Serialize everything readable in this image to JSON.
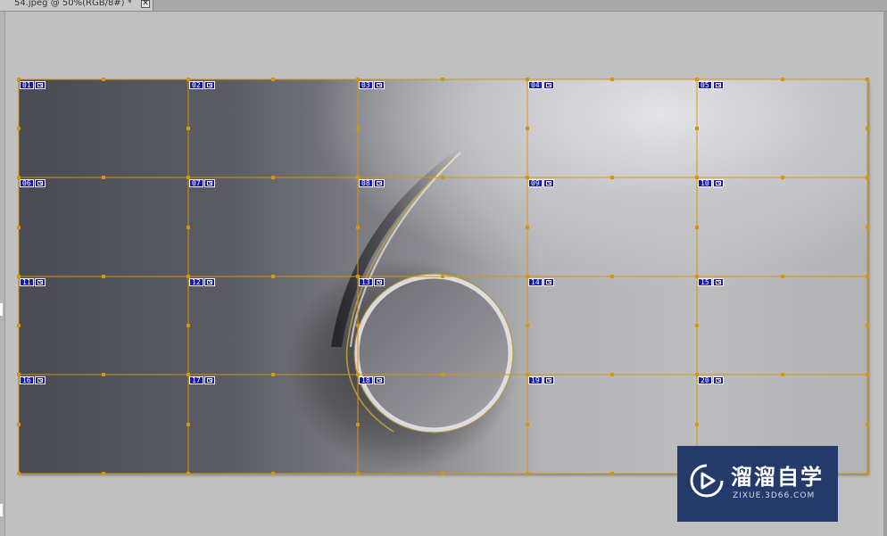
{
  "document_tab": {
    "title": "54.jpeg @ 50%(RGB/8#) *",
    "close_symbol": "✕"
  },
  "slices": [
    {
      "number": "01"
    },
    {
      "number": "02"
    },
    {
      "number": "03"
    },
    {
      "number": "04"
    },
    {
      "number": "05"
    },
    {
      "number": "06"
    },
    {
      "number": "07"
    },
    {
      "number": "08"
    },
    {
      "number": "09"
    },
    {
      "number": "10"
    },
    {
      "number": "11"
    },
    {
      "number": "12"
    },
    {
      "number": "13"
    },
    {
      "number": "14"
    },
    {
      "number": "15"
    },
    {
      "number": "16"
    },
    {
      "number": "17"
    },
    {
      "number": "18"
    },
    {
      "number": "19"
    },
    {
      "number": "20"
    }
  ],
  "watermark": {
    "title": "溜溜自学",
    "url": "ZIXUE.3D66.COM"
  },
  "colors": {
    "slice_line": "#d4960a",
    "slice_badge": "#1a1aa8",
    "watermark_bg": "#233a6a"
  }
}
